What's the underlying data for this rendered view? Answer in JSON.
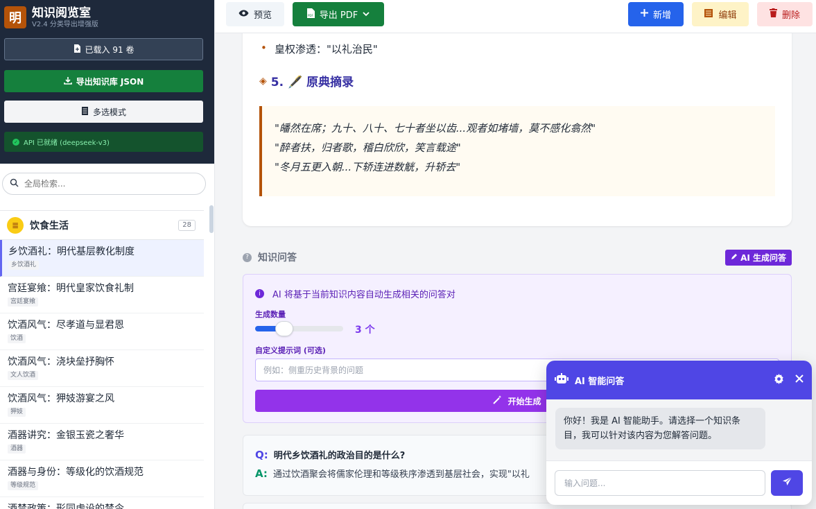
{
  "brand": {
    "logo": "明",
    "title": "知识阅览室",
    "subtitle": "V2.4 分类导出增强版"
  },
  "sidebar": {
    "loaded_label": "已载入 91 卷",
    "export_label": "导出知识库 JSON",
    "multiselect_label": "多选模式",
    "api_status": "API 已就绪 (deepseek-v3)",
    "search_placeholder": "全局检索...",
    "category": {
      "name": "饮食生活",
      "count": "28"
    },
    "items": [
      {
        "title": "乡饮酒礼：明代基层教化制度",
        "tag": "乡饮酒礼"
      },
      {
        "title": "宫廷宴飨：明代皇家饮食礼制",
        "tag": "宫廷宴飨"
      },
      {
        "title": "饮酒风气：尽孝道与显君恩",
        "tag": "饮酒"
      },
      {
        "title": "饮酒风气：浇块垒抒胸怀",
        "tag": "文人饮酒"
      },
      {
        "title": "饮酒风气：狎妓游宴之风",
        "tag": "狎妓"
      },
      {
        "title": "酒器讲究：金银玉瓷之奢华",
        "tag": "酒器"
      },
      {
        "title": "酒器与身份：等级化的饮酒规范",
        "tag": "等级规范"
      },
      {
        "title": "酒禁政策：形同虚设的禁令",
        "tag": ""
      }
    ]
  },
  "toolbar": {
    "preview_label": "预览",
    "pdf_label": "导出 PDF",
    "new_label": "新增",
    "edit_label": "编辑",
    "delete_label": "删除"
  },
  "content": {
    "bullet": "皇权渗透：\"以礼治民\"",
    "section_title": "5. 🖋️ 原典摘录",
    "quotes": [
      "\"皤然在席；九十、八十、七十者坐以齿...观者如堵墙，莫不感化翕然\"",
      "\"醉者扶，归者歌，稽白欣欣，笑言载途\"",
      "\"冬月五更入朝...下轿连进数觥，升轿去\""
    ]
  },
  "qa": {
    "header": "知识问答",
    "ai_generate_label": "AI 生成问答",
    "info": "AI 将基于当前知识内容自动生成相关的问答对",
    "count_label": "生成数量",
    "count_value": "3 个",
    "count_fraction": 0.27,
    "prompt_label": "自定义提示词 (可选)",
    "prompt_placeholder": "例如：侧重历史背景的问题",
    "start_label": "开始生成",
    "q_mark": "Q:",
    "a_mark": "A:",
    "question": "明代乡饮酒礼的政治目的是什么?",
    "answer": "通过饮酒聚会将儒家伦理和等级秩序渗透到基层社会，实现\"以礼"
  },
  "chat": {
    "title": "AI 智能问答",
    "greeting": "你好！我是 AI 智能助手。请选择一个知识条目，我可以针对该内容为您解答问题。",
    "input_placeholder": "输入问题..."
  },
  "colors": {
    "sidebar_dark": "#1e293b",
    "export_green": "#15803d",
    "primary_blue": "#2563eb",
    "accent_indigo": "#4f46e5",
    "purple": "#9333ea",
    "amber": "#b45309"
  }
}
